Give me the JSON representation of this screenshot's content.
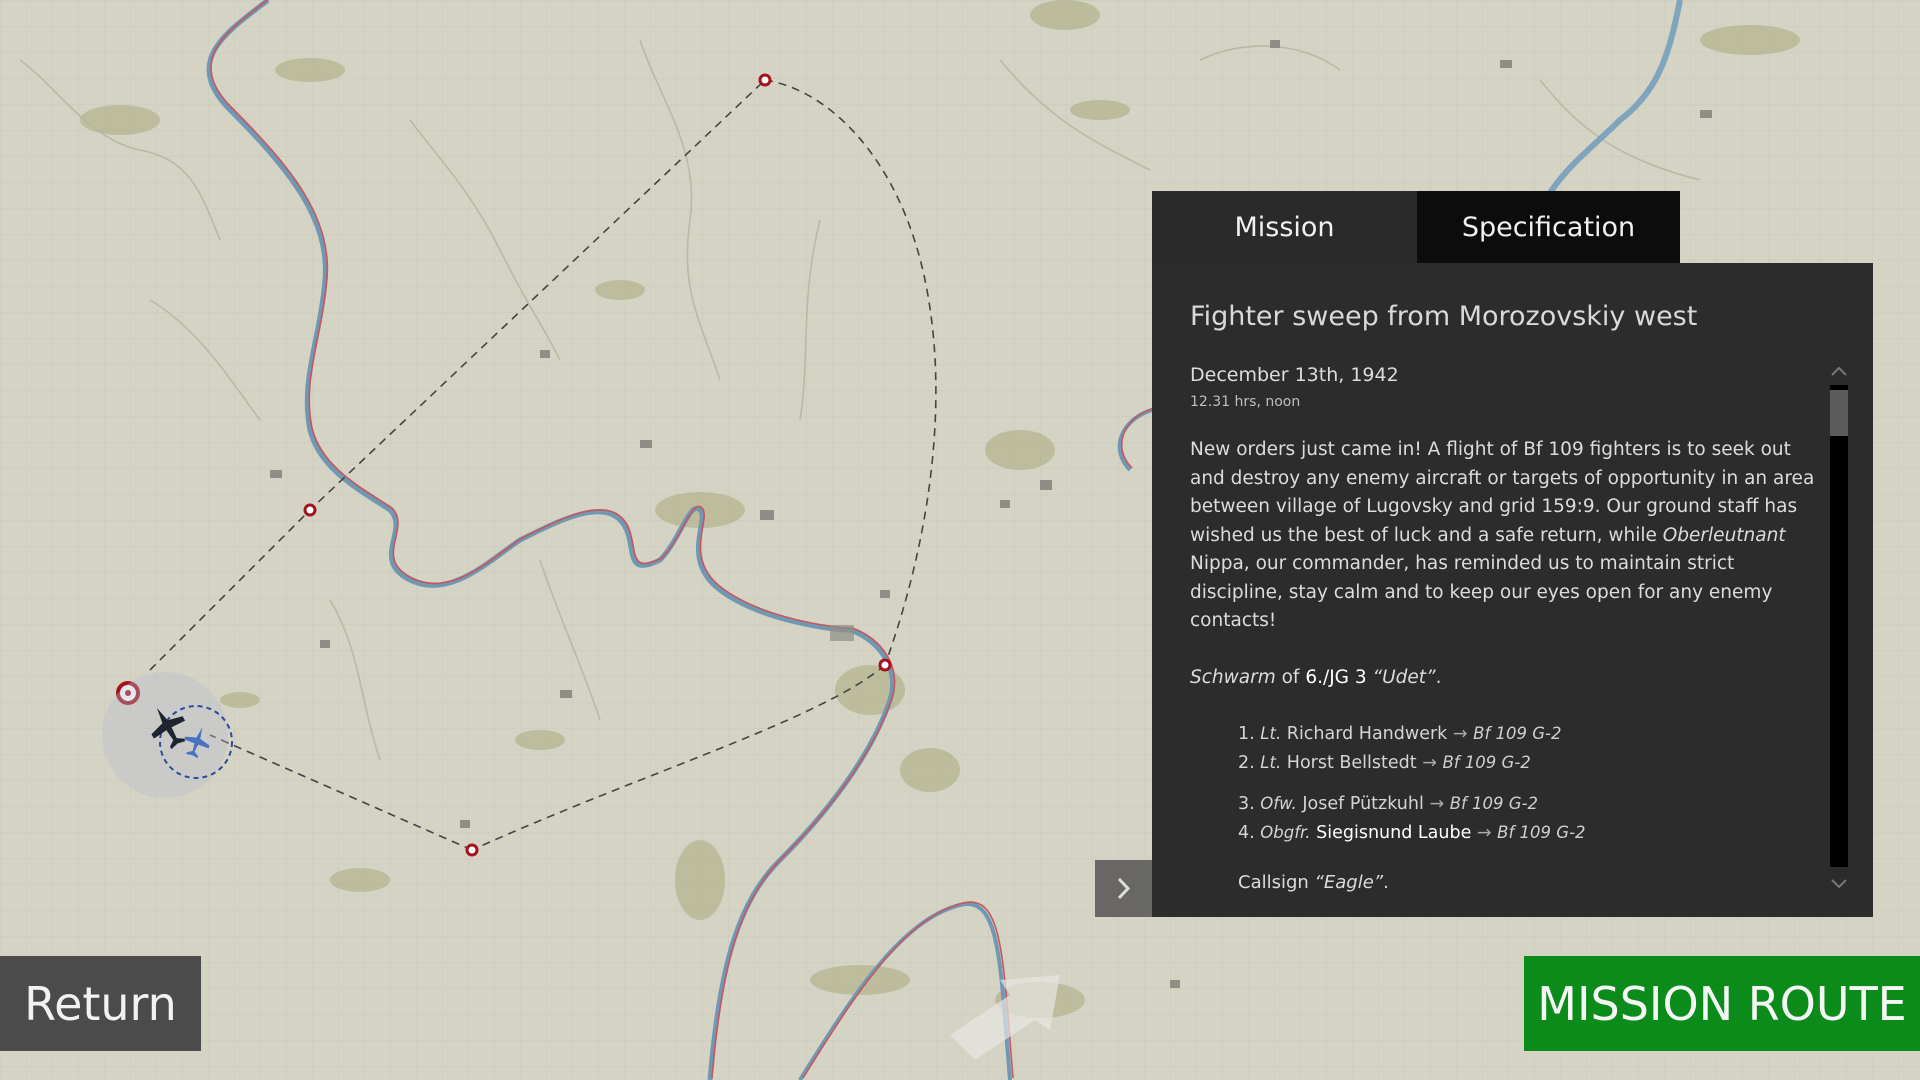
{
  "tabs": {
    "mission": "Mission",
    "specification": "Specification"
  },
  "briefing": {
    "title": "Fighter sweep from Morozovskiy west",
    "date": "December 13th, 1942",
    "time": "12.31 hrs, noon",
    "text_part1": "New orders just came in! A flight of Bf 109 fighters is to seek out and destroy any enemy aircraft or targets of opportunity in an area between village of Lugovsky and grid 159:9. Our ground staff has wished us the best of luck and a safe return, while ",
    "text_rank": "Oberleutnant",
    "text_part2": " Nippa, our commander, has reminded us to maintain strict discipline, stay calm and to keep our eyes open for any enemy contacts!",
    "unit_prefix": "Schwarm",
    "unit_of": " of ",
    "unit_name": "6./JG 3",
    "unit_nick": " “Udet”",
    "unit_suffix": ".",
    "pilots": [
      {
        "num": "1.",
        "rank": "Lt.",
        "name": "Richard Handwerk",
        "aircraft": "Bf 109 G-2",
        "highlight": false
      },
      {
        "num": "2.",
        "rank": "Lt.",
        "name": "Horst Bellstedt",
        "aircraft": "Bf 109 G-2",
        "highlight": false
      },
      {
        "num": "3.",
        "rank": "Ofw.",
        "name": "Josef Pützkuhl",
        "aircraft": "Bf 109 G-2",
        "highlight": false
      },
      {
        "num": "4.",
        "rank": "Obgfr.",
        "name": "Siegisnund Laube",
        "aircraft": "Bf 109 G-2",
        "highlight": true
      }
    ],
    "arrow": "→",
    "callsign_label": "Callsign ",
    "callsign_value": "“Eagle”",
    "callsign_suffix": "."
  },
  "buttons": {
    "return": "Return",
    "mission_route": "MISSION ROUTE"
  },
  "icons": {
    "collapse": "chevron-right-icon",
    "scroll_up": "chevron-up-icon",
    "scroll_down": "chevron-down-icon",
    "player_aircraft": "aircraft-icon",
    "airfield": "airfield-icon"
  },
  "colors": {
    "panel": "#2c2c2c",
    "tab_active": "#2a2a2a",
    "tab_inactive": "#0c0c0c",
    "route_button": "#0a8b1a",
    "return_button": "#4b4b4b",
    "waypoint": "#a3131b",
    "river": "#6a9ab8",
    "frontline": "#c0535a",
    "map_bg": "#d5d3c4"
  }
}
